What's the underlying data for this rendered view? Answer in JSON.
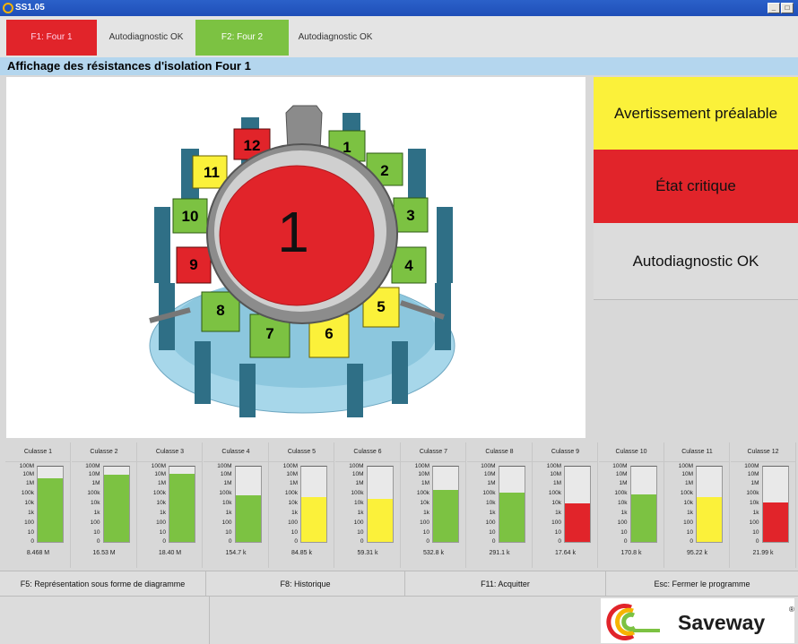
{
  "window": {
    "title": "SS1.05",
    "minimize": "_",
    "maximize": "□"
  },
  "tabs": [
    {
      "label": "F1: Four 1",
      "style": "red"
    },
    {
      "label": "Autodiagnostic OK",
      "style": "gray"
    },
    {
      "label": "F2: Four 2",
      "style": "green"
    },
    {
      "label": "Autodiagnostic OK",
      "style": "gray"
    }
  ],
  "section_title": "Affichage des résistances d'isolation Four 1",
  "diagram": {
    "center_label": "1",
    "segments": [
      {
        "num": "1",
        "state": "green"
      },
      {
        "num": "2",
        "state": "green"
      },
      {
        "num": "3",
        "state": "green"
      },
      {
        "num": "4",
        "state": "green"
      },
      {
        "num": "5",
        "state": "yellow"
      },
      {
        "num": "6",
        "state": "yellow"
      },
      {
        "num": "7",
        "state": "green"
      },
      {
        "num": "8",
        "state": "green"
      },
      {
        "num": "9",
        "state": "red"
      },
      {
        "num": "10",
        "state": "green"
      },
      {
        "num": "11",
        "state": "yellow"
      },
      {
        "num": "12",
        "state": "red"
      }
    ]
  },
  "status_boxes": {
    "warning": "Avertissement préalable",
    "critical": "État critique",
    "ok": "Autodiagnostic OK"
  },
  "colors": {
    "red": "#e1242a",
    "green": "#7cc242",
    "yellow": "#fbf13a"
  },
  "scale_labels": [
    "100M",
    "10M",
    "1M",
    "100k",
    "10k",
    "1k",
    "100",
    "10",
    "0"
  ],
  "gauges": [
    {
      "name": "Culasse 1",
      "value": "8.468 M",
      "level": 0.84,
      "state": "green"
    },
    {
      "name": "Culasse 2",
      "value": "16.53 M",
      "level": 0.89,
      "state": "green"
    },
    {
      "name": "Culasse 3",
      "value": "18.40 M",
      "level": 0.9,
      "state": "green"
    },
    {
      "name": "Culasse 4",
      "value": "154.7 k",
      "level": 0.62,
      "state": "green"
    },
    {
      "name": "Culasse 5",
      "value": "84.85 k",
      "level": 0.59,
      "state": "yellow"
    },
    {
      "name": "Culasse 6",
      "value": "59.31 k",
      "level": 0.57,
      "state": "yellow"
    },
    {
      "name": "Culasse 7",
      "value": "532.8 k",
      "level": 0.69,
      "state": "green"
    },
    {
      "name": "Culasse 8",
      "value": "291.1 k",
      "level": 0.65,
      "state": "green"
    },
    {
      "name": "Culasse 9",
      "value": "17.64 k",
      "level": 0.51,
      "state": "red"
    },
    {
      "name": "Culasse 10",
      "value": "170.8 k",
      "level": 0.63,
      "state": "green"
    },
    {
      "name": "Culasse 11",
      "value": "95.22 k",
      "level": 0.6,
      "state": "yellow"
    },
    {
      "name": "Culasse 12",
      "value": "21.99 k",
      "level": 0.52,
      "state": "red"
    }
  ],
  "function_keys": [
    "F5: Représentation sous forme de diagramme",
    "F8: Historique",
    "F11: Acquitter",
    "Esc: Fermer le programme"
  ],
  "logo": {
    "text": "Saveway",
    "reg": "®"
  }
}
